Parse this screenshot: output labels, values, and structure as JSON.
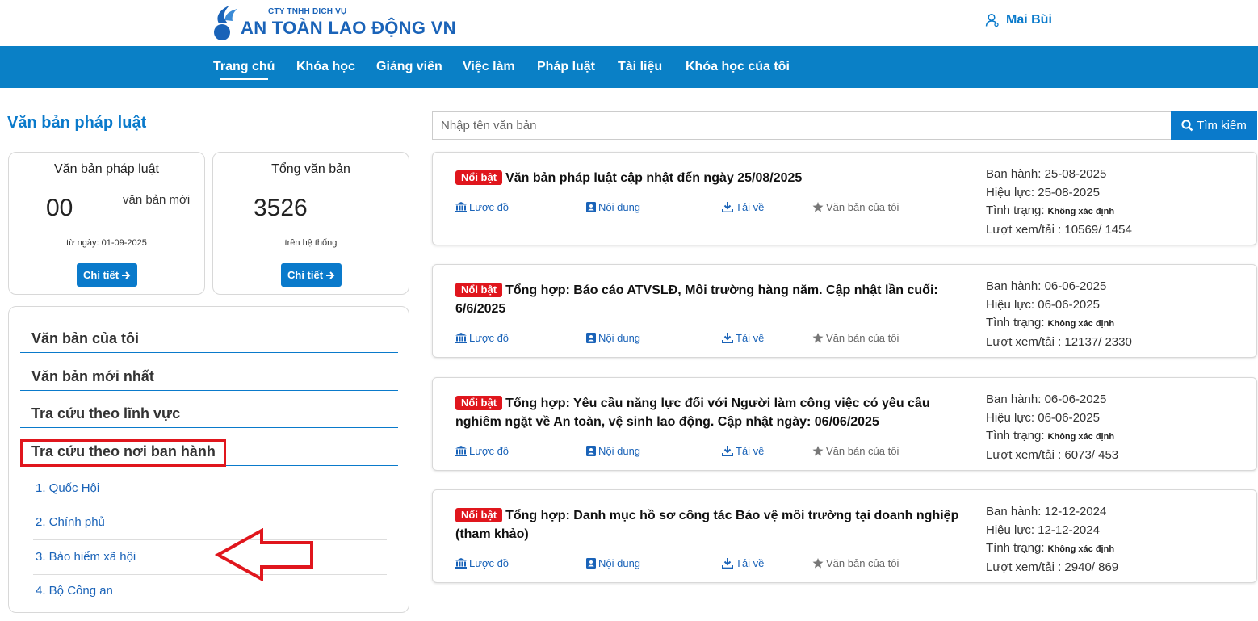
{
  "header": {
    "logo_small": "CTY TNHH DỊCH VỤ",
    "logo_big": "AN TOÀN LAO ĐỘNG VN",
    "user_name": "Mai Bùi"
  },
  "nav": {
    "items": [
      "Trang chủ",
      "Khóa học",
      "Giảng viên",
      "Việc làm",
      "Pháp luật",
      "Tài liệu",
      "Khóa học của tôi"
    ],
    "active": "Trang chủ"
  },
  "left": {
    "section_title": "Văn bản pháp luật",
    "card_new": {
      "heading": "Văn bản pháp luật",
      "number": "00",
      "unit": "văn bản mới",
      "sub": "từ ngày: 01-09-2025",
      "button": "Chi tiết"
    },
    "card_total": {
      "heading": "Tổng văn bản",
      "number": "3526",
      "sub": "trên hệ thống",
      "button": "Chi tiết"
    },
    "menu": [
      "Văn bản của tôi",
      "Văn bản mới nhất",
      "Tra cứu theo lĩnh vực",
      "Tra cứu theo nơi ban hành"
    ],
    "sub_items": [
      "1. Quốc Hội",
      "2. Chính phủ",
      "3. Bảo hiểm xã hội",
      "4. Bộ Công an"
    ]
  },
  "search": {
    "placeholder": "Nhập tên văn bản",
    "button": "Tìm kiếm"
  },
  "doc_labels": {
    "badge": "Nổi bật",
    "action_map": "Lược đồ",
    "action_content": "Nội dung",
    "action_download": "Tải về",
    "action_mine": "Văn bản của tôi",
    "issued": "Ban hành:",
    "effective": "Hiệu lực:",
    "status": "Tình trạng:",
    "views": "Lượt xem/tải :"
  },
  "documents": [
    {
      "title": "Văn bản pháp luật cập nhật đến ngày 25/08/2025",
      "issued": "25-08-2025",
      "effective": "25-08-2025",
      "status": "Không xác định",
      "views": "10569/ 1454"
    },
    {
      "title": "Tổng hợp: Báo cáo ATVSLĐ, Môi trường hàng năm. Cập nhật lần cuối: 6/6/2025",
      "issued": "06-06-2025",
      "effective": "06-06-2025",
      "status": "Không xác định",
      "views": "12137/ 2330"
    },
    {
      "title": "Tổng hợp: Yêu cầu năng lực đối với Người làm công việc có yêu cầu nghiêm ngặt về An toàn, vệ sinh lao động. Cập nhật ngày: 06/06/2025",
      "issued": "06-06-2025",
      "effective": "06-06-2025",
      "status": "Không xác định",
      "views": "6073/ 453"
    },
    {
      "title": "Tổng hợp: Danh mục hồ sơ công tác Bảo vệ môi trường tại doanh nghiệp (tham khảo)",
      "issued": "12-12-2024",
      "effective": "12-12-2024",
      "status": "Không xác định",
      "views": "2940/ 869"
    }
  ],
  "colors": {
    "brand": "#0a80c6",
    "link": "#1a63b8",
    "badge": "#e0161d",
    "annotation": "#e0161d"
  }
}
